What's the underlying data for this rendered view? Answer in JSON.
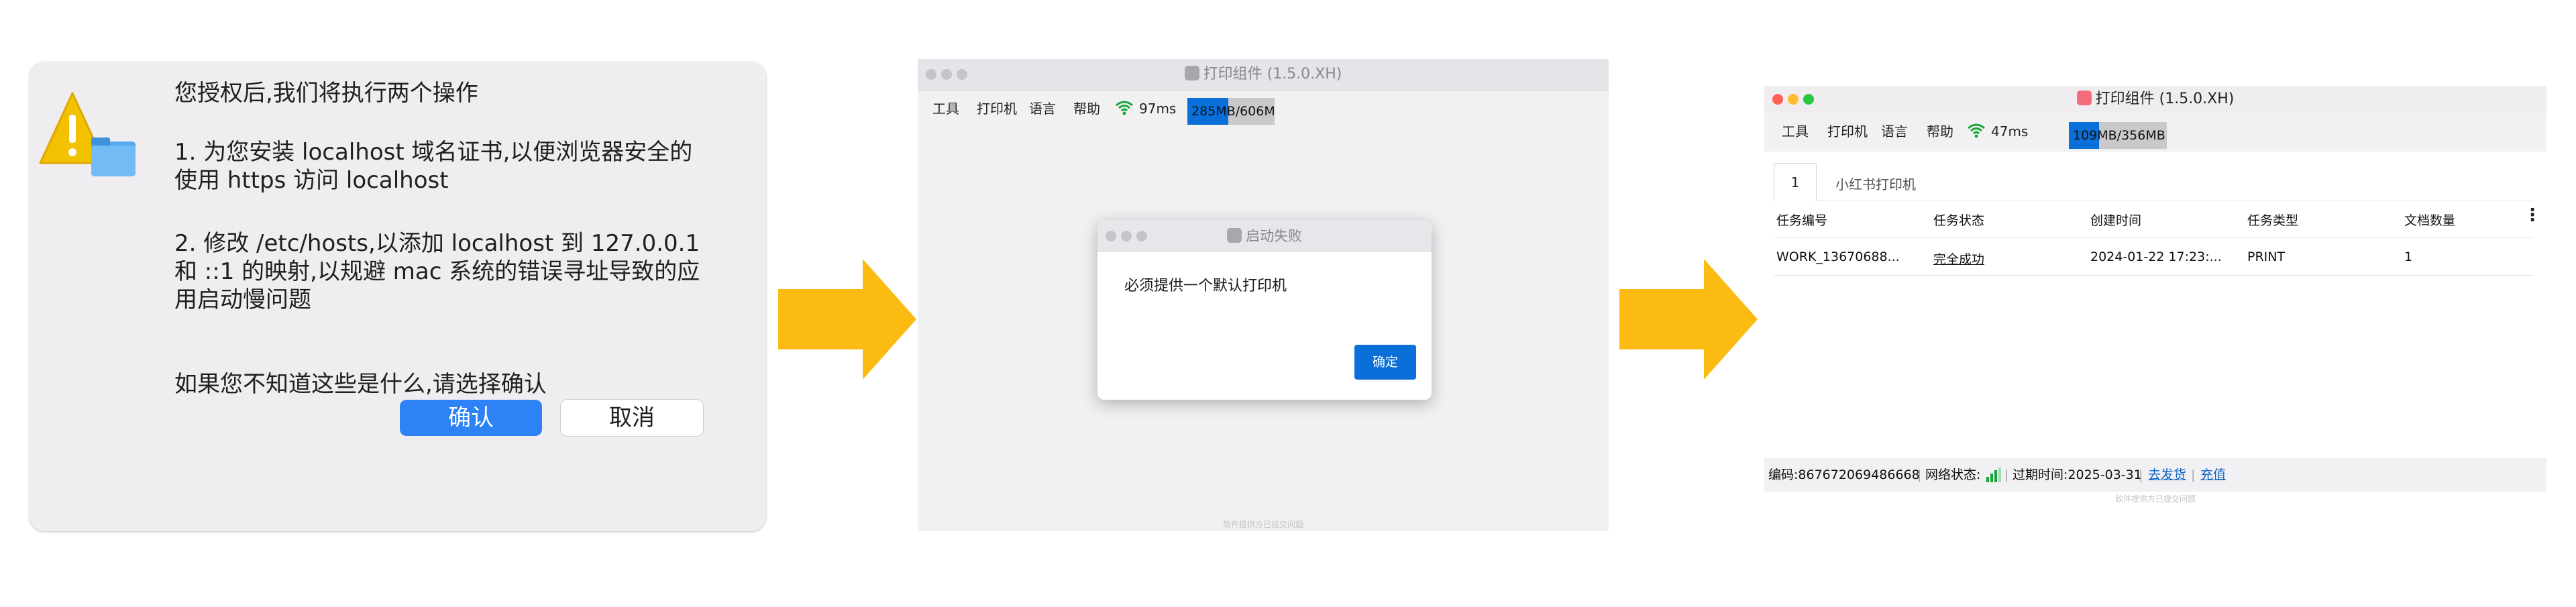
{
  "auth_dialog": {
    "title": "您授权后,我们将执行两个操作",
    "item1": "1. 为您安装 localhost 域名证书,以便浏览器安全的使用 https 访问 localhost",
    "item2": "2. 修改 /etc/hosts,以添加 localhost 到 127.0.0.1 和 ::1 的映射,以规避 mac 系统的错误寻址导致的应用启动慢问题",
    "note": "如果您不知道这些是什么,请选择确认",
    "confirm_label": "确认",
    "cancel_label": "取消",
    "icon": "warning-folder-icon"
  },
  "arrow_color": "#fbbb13",
  "window2": {
    "title": "打印组件 (1.5.0.XH)",
    "menu": [
      "工具",
      "打印机",
      "语言",
      "帮助"
    ],
    "latency": "97ms",
    "memory": "285MB/606MB",
    "memory_fraction": 0.47,
    "modal": {
      "title": "启动失败",
      "message": "必须提供一个默认打印机",
      "ok_label": "确定"
    },
    "footer_hint": "软件提供方已提交问题"
  },
  "window3": {
    "title": "打印组件 (1.5.0.XH)",
    "menu": [
      "工具",
      "打印机",
      "语言",
      "帮助"
    ],
    "latency": "47ms",
    "memory": "109MB/356MB",
    "memory_fraction": 0.31,
    "tabs": [
      "1",
      "小红书打印机"
    ],
    "columns": [
      "任务编号",
      "任务状态",
      "创建时间",
      "任务类型",
      "文档数量"
    ],
    "rows": [
      {
        "id": "WORK_13670688...",
        "status": "完全成功",
        "created": "2024-01-22 17:23:...",
        "type": "PRINT",
        "count": "1"
      }
    ],
    "status_bar": {
      "code": "编码:867672069486668",
      "network_label": "网络状态:",
      "expiry": "过期时间:2025-03-31",
      "link1": "去发货",
      "link2": "充值"
    },
    "footer_hint": "软件提供方已提交问题"
  }
}
